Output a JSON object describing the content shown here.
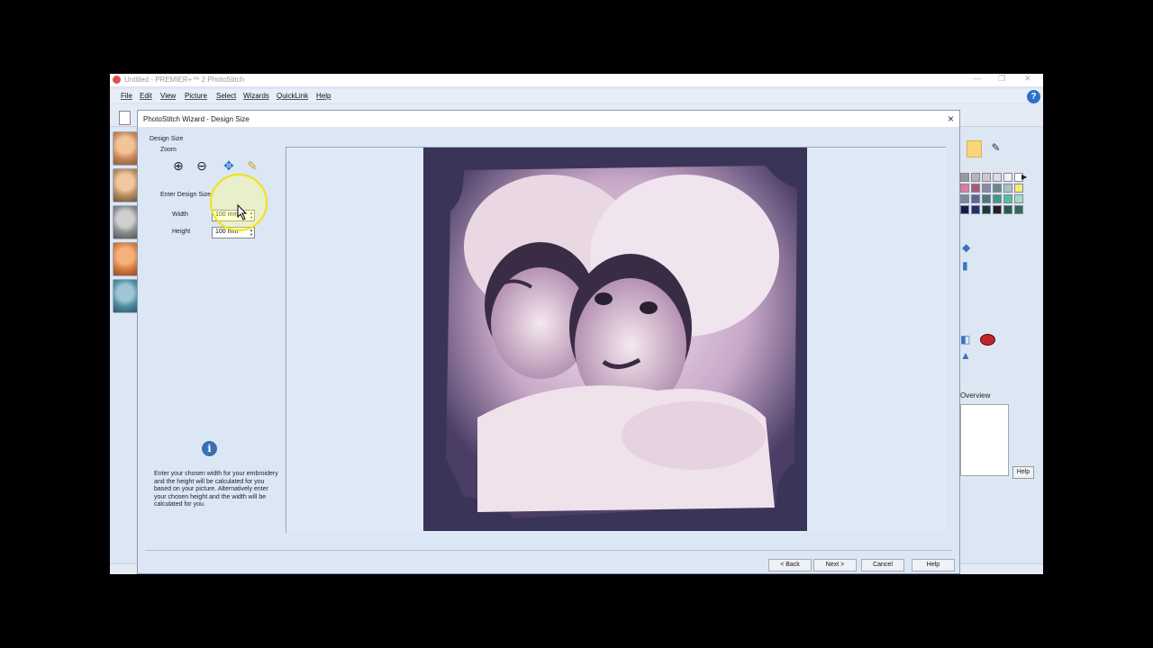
{
  "app": {
    "title": "Untitled - PREMIER+™ 2 PhotoStitch",
    "menu": [
      "File",
      "Edit",
      "View",
      "Picture",
      "Select",
      "Wizards",
      "QuickLink",
      "Help"
    ],
    "help_icon": "?",
    "right_panel": {
      "overview_label": "Overview",
      "help_label": "Help"
    }
  },
  "dialog": {
    "title": "PhotoStitch Wizard - Design Size",
    "close": "×",
    "section_label": "Design Size",
    "zoom_label": "Zoom",
    "enter_label": "Enter Design Size",
    "width_label": "Width",
    "width_value": "100 mm",
    "height_label": "Height",
    "height_value": "100 mm",
    "info_text": "Enter your chosen width for your embroidery and the height will be calculated for you based on your picture. Alternatively enter your chosen height and the width will be calculated for you.",
    "buttons": {
      "back": "< Back",
      "next": "Next >",
      "cancel": "Cancel",
      "help": "Help"
    }
  },
  "colors": {
    "accent": "#2a72c8",
    "highlight": "#f1e20e",
    "dialog_bg": "#dce7f6"
  }
}
